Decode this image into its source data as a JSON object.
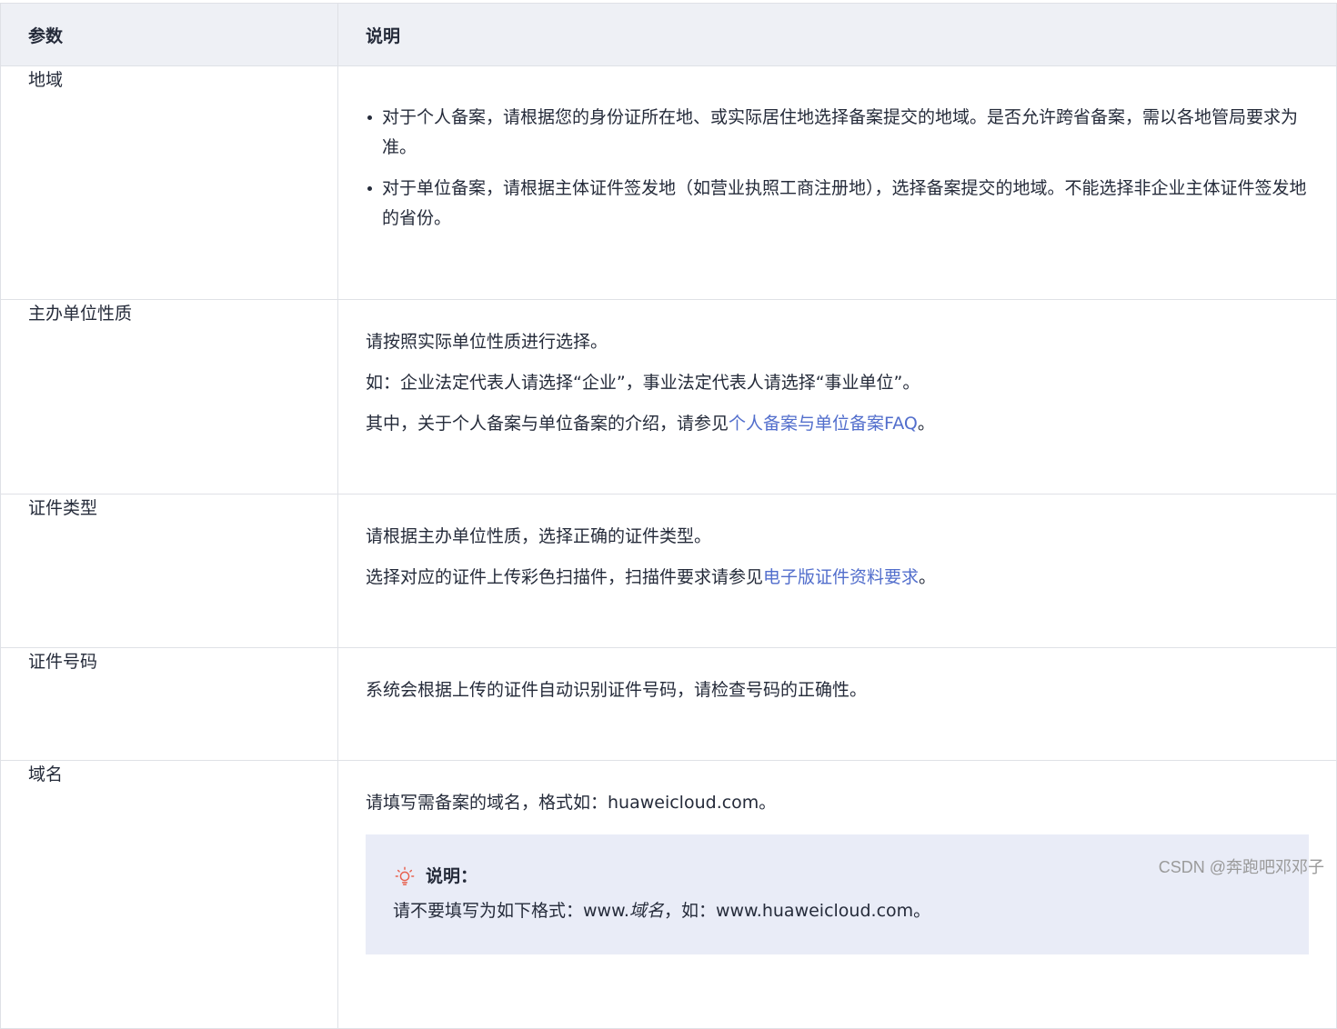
{
  "table": {
    "headers": [
      "参数",
      "说明"
    ],
    "rows": {
      "region": {
        "name": "地域",
        "bullets": [
          "对于个人备案，请根据您的身份证所在地、或实际居住地选择备案提交的地域。是否允许跨省备案，需以各地管局要求为准。",
          "对于单位备案，请根据主体证件签发地（如营业执照工商注册地），选择备案提交的地域。不能选择非企业主体证件签发地的省份。"
        ]
      },
      "nature": {
        "name": "主办单位性质",
        "p1": "请按照实际单位性质进行选择。",
        "p2": "如：企业法定代表人请选择“企业”，事业法定代表人请选择“事业单位”。",
        "p3_prefix": "其中，关于个人备案与单位备案的介绍，请参见",
        "p3_link": "个人备案与单位备案FAQ",
        "p3_suffix": "。"
      },
      "cert_type": {
        "name": "证件类型",
        "p1": "请根据主办单位性质，选择正确的证件类型。",
        "p2_prefix": "选择对应的证件上传彩色扫描件，扫描件要求请参见",
        "p2_link": "电子版证件资料要求",
        "p2_suffix": "。"
      },
      "cert_number": {
        "name": "证件号码",
        "p1": "系统会根据上传的证件自动识别证件号码，请检查号码的正确性。"
      },
      "domain": {
        "name": "域名",
        "p1": "请填写需备案的域名，格式如：huaweicloud.com。",
        "note": {
          "icon": "lightbulb-icon",
          "title": "说明：",
          "text_prefix": "请不要填写为如下格式：www.",
          "text_italic": "域名",
          "text_suffix": "，如：www.huaweicloud.com。"
        }
      }
    }
  },
  "watermark": "CSDN @奔跑吧邓邓子",
  "colors": {
    "header_bg": "#eef0f5",
    "border": "#dfe1e6",
    "link": "#526ecc",
    "note_bg": "#e9ecf7",
    "icon": "#e8614f"
  }
}
